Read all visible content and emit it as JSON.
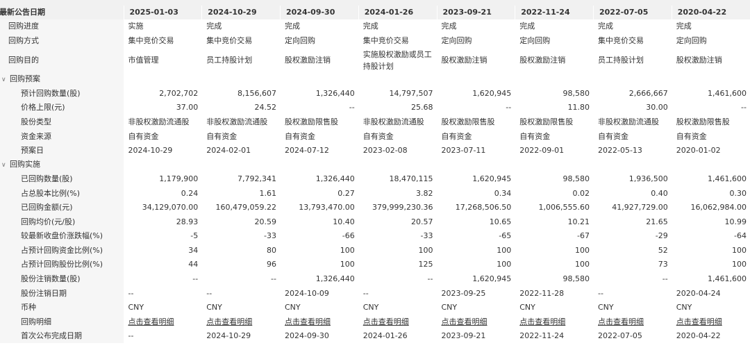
{
  "header": {
    "label": "最新公告日期",
    "dates": [
      "2025-01-03",
      "2024-10-29",
      "2024-09-30",
      "2024-01-26",
      "2023-09-21",
      "2022-11-24",
      "2022-07-05",
      "2020-04-22"
    ]
  },
  "rows": {
    "progress": {
      "label": "回购进度",
      "values": [
        "实施",
        "完成",
        "完成",
        "完成",
        "完成",
        "完成",
        "完成",
        "完成"
      ]
    },
    "method": {
      "label": "回购方式",
      "values": [
        "集中竞价交易",
        "集中竞价交易",
        "定向回购",
        "集中竞价交易",
        "定向回购",
        "定向回购",
        "集中竞价交易",
        "定向回购"
      ]
    },
    "purpose": {
      "label": "回购目的",
      "values": [
        "市值管理",
        "员工持股计划",
        "股权激励注销",
        "实施股权激励或员工持股计划",
        "股权激励注销",
        "股权激励注销",
        "员工持股计划",
        "股权激励注销"
      ]
    },
    "plan_section": {
      "label": "回购预案",
      "twisty": "∨"
    },
    "plan_qty": {
      "label": "预计回购数量(股)",
      "values": [
        "2,702,702",
        "8,156,607",
        "1,326,440",
        "14,797,507",
        "1,620,945",
        "98,580",
        "2,666,667",
        "1,461,600"
      ]
    },
    "price_cap": {
      "label": "价格上限(元)",
      "values": [
        "37.00",
        "24.52",
        "--",
        "25.68",
        "--",
        "11.80",
        "30.00",
        "--"
      ]
    },
    "share_type": {
      "label": "股份类型",
      "values": [
        "非股权激励流通股",
        "非股权激励流通股",
        "股权激励限售股",
        "非股权激励流通股",
        "股权激励限售股",
        "股权激励限售股",
        "非股权激励流通股",
        "股权激励限售股"
      ]
    },
    "fund_source": {
      "label": "资金来源",
      "values": [
        "自有资金",
        "自有资金",
        "自有资金",
        "自有资金",
        "自有资金",
        "自有资金",
        "自有资金",
        "自有资金"
      ]
    },
    "plan_date": {
      "label": "预案日",
      "values": [
        "2024-10-29",
        "2024-02-01",
        "2024-07-12",
        "2023-02-08",
        "2023-07-11",
        "2022-09-01",
        "2022-05-13",
        "2020-01-02"
      ]
    },
    "impl_section": {
      "label": "回购实施",
      "twisty": "∨"
    },
    "done_qty": {
      "label": "已回购数量(股)",
      "values": [
        "1,179,900",
        "7,792,341",
        "1,326,440",
        "18,470,115",
        "1,620,945",
        "98,580",
        "1,936,500",
        "1,461,600"
      ]
    },
    "pct_total": {
      "label": "占总股本比例(%)",
      "values": [
        "0.24",
        "1.61",
        "0.27",
        "3.82",
        "0.34",
        "0.02",
        "0.40",
        "0.30"
      ]
    },
    "amount": {
      "label": "已回购金额(元)",
      "values": [
        "34,129,070.00",
        "160,479,059.22",
        "13,793,470.00",
        "379,999,230.36",
        "17,268,506.50",
        "1,006,555.60",
        "41,927,729.00",
        "16,062,984.00"
      ]
    },
    "avg_price": {
      "label": "回购均价(元/股)",
      "values": [
        "28.93",
        "20.59",
        "10.40",
        "20.57",
        "10.65",
        "10.21",
        "21.65",
        "10.99"
      ]
    },
    "vs_close": {
      "label": "较最新收盘价涨跌幅(%)",
      "values": [
        "-5",
        "-33",
        "-66",
        "-33",
        "-65",
        "-67",
        "-29",
        "-64"
      ]
    },
    "fund_ratio": {
      "label": "占预计回购资金比例(%)",
      "values": [
        "34",
        "80",
        "100",
        "100",
        "100",
        "100",
        "52",
        "100"
      ]
    },
    "share_ratio": {
      "label": "占预计回购股份比例(%)",
      "values": [
        "44",
        "96",
        "100",
        "125",
        "100",
        "100",
        "73",
        "100"
      ]
    },
    "cancel_qty": {
      "label": "股份注销数量(股)",
      "values": [
        "--",
        "--",
        "1,326,440",
        "--",
        "1,620,945",
        "98,580",
        "--",
        "1,461,600"
      ]
    },
    "cancel_date": {
      "label": "股份注销日期",
      "values": [
        "--",
        "--",
        "2024-10-09",
        "--",
        "2023-09-25",
        "2022-11-28",
        "--",
        "2020-04-24"
      ]
    },
    "currency": {
      "label": "币种",
      "values": [
        "CNY",
        "CNY",
        "CNY",
        "CNY",
        "CNY",
        "CNY",
        "CNY",
        "CNY"
      ]
    },
    "detail": {
      "label": "回购明细",
      "values": [
        "点击查看明细",
        "点击查看明细",
        "点击查看明细",
        "点击查看明细",
        "点击查看明细",
        "点击查看明细",
        "点击查看明细",
        "点击查看明细"
      ]
    },
    "first_done": {
      "label": "首次公布完成日期",
      "values": [
        "--",
        "2024-10-29",
        "2024-09-30",
        "2024-01-26",
        "2023-09-21",
        "2022-11-24",
        "2022-07-05",
        "2020-04-22"
      ]
    }
  }
}
